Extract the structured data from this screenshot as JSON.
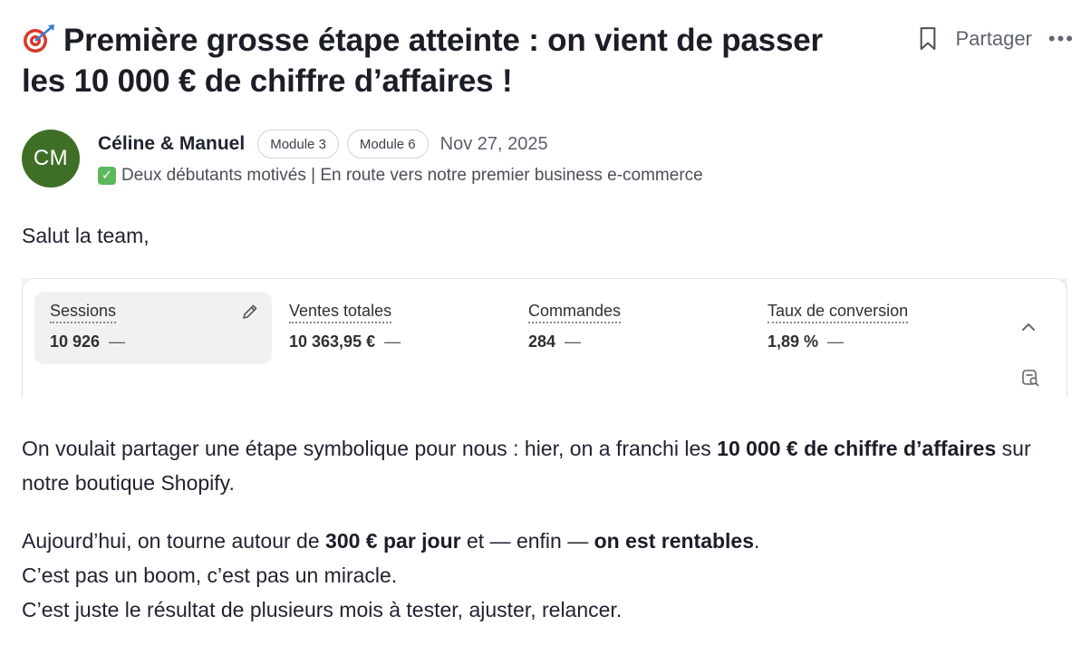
{
  "post": {
    "title": "Première grosse étape atteinte : on vient de passer les 10 000 € de chiffre d’affaires !",
    "title_emoji": "dart-target-icon"
  },
  "actions": {
    "share_label": "Partager",
    "more_label": "•••"
  },
  "author": {
    "initials": "CM",
    "avatar_color": "#3f6f26",
    "name": "Céline & Manuel",
    "badges": [
      "Module 3",
      "Module 6"
    ],
    "date": "Nov 27, 2025",
    "bio": "Deux débutants motivés | En route vers notre premier business e-commerce"
  },
  "body": {
    "greeting": "Salut la team,",
    "p1_part1": "On voulait partager une étape symbolique pour nous : hier, on a franchi les ",
    "p1_bold": "10 000 € de chiffre d’affaires",
    "p1_part2": " sur notre boutique Shopify.",
    "p2_line1_a": "Aujourd’hui, on tourne autour de ",
    "p2_line1_bold1": "300 € par jour",
    "p2_line1_b": " et — enfin — ",
    "p2_line1_bold2": "on est rentables",
    "p2_line1_c": ".",
    "p2_line2": "C’est pas un boom, c’est pas un miracle.",
    "p2_line3": "C’est juste le résultat de plusieurs mois à tester, ajuster, relancer."
  },
  "dashboard": {
    "metrics": [
      {
        "label": "Sessions",
        "value": "10 926",
        "trend": "—"
      },
      {
        "label": "Ventes totales",
        "value": "10 363,95 €",
        "trend": "—"
      },
      {
        "label": "Commandes",
        "value": "284",
        "trend": "—"
      },
      {
        "label": "Taux de conversion",
        "value": "1,89 %",
        "trend": "—"
      }
    ]
  }
}
